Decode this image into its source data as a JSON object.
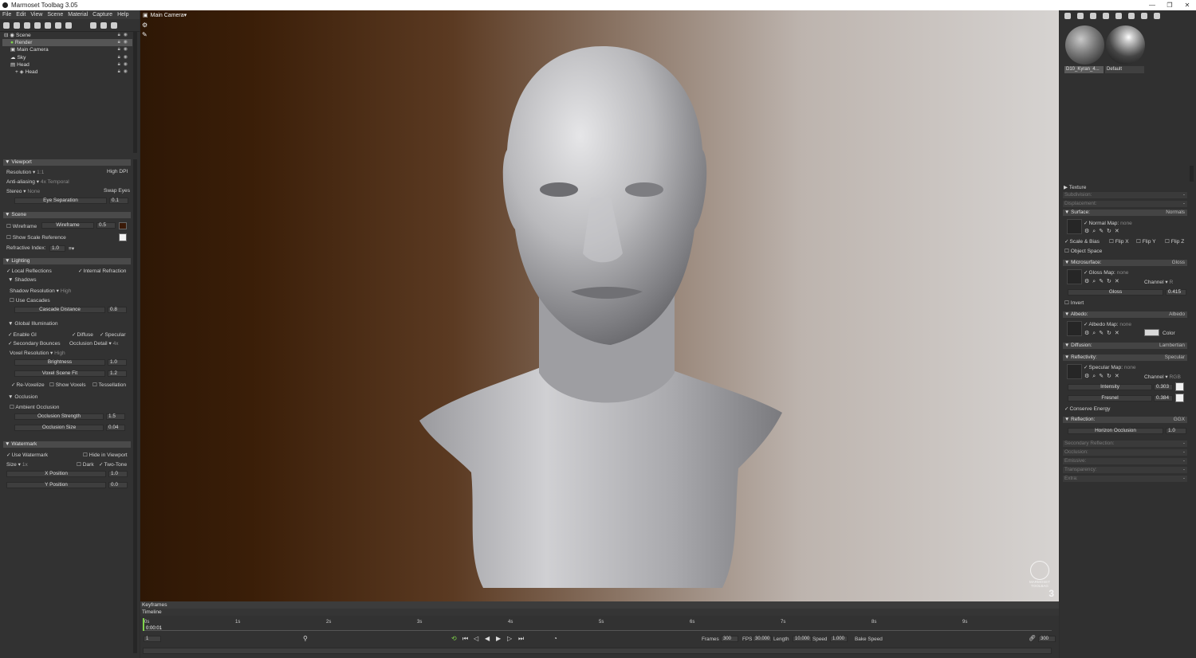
{
  "window": {
    "title": "Marmoset Toolbag 3.05",
    "controls": [
      "—",
      "❐",
      "✕"
    ]
  },
  "menu": [
    "File",
    "Edit",
    "View",
    "Scene",
    "Material",
    "Capture",
    "Help"
  ],
  "scene_tree": [
    {
      "label": "Scene",
      "indent": 0,
      "selected": false
    },
    {
      "label": "Render",
      "indent": 1,
      "selected": true
    },
    {
      "label": "Main Camera",
      "indent": 1,
      "selected": false
    },
    {
      "label": "Sky",
      "indent": 1,
      "selected": false
    },
    {
      "label": "Head",
      "indent": 1,
      "selected": false
    },
    {
      "label": "Head",
      "indent": 2,
      "selected": false
    }
  ],
  "viewport_panel": {
    "title": "Viewport",
    "resolution_label": "Resolution",
    "resolution_value": "1:1",
    "high_dpi": "High DPI",
    "aa_label": "Anti-aliasing",
    "aa_value": "4x Temporal",
    "stereo_label": "Stereo",
    "stereo_value": "None",
    "swap_eyes": "Swap Eyes",
    "eye_sep_label": "Eye Separation",
    "eye_sep_value": "0.1"
  },
  "scene_panel": {
    "title": "Scene",
    "wireframe_label": "Wireframe",
    "wireframe_slider": "Wireframe",
    "wireframe_value": "0.5",
    "show_scale": "Show Scale Reference",
    "refractive_label": "Refractive Index:",
    "refractive_value": "1.0"
  },
  "lighting_panel": {
    "title": "Lighting",
    "local_reflections": "Local Reflections",
    "internal_refraction": "Internal Refraction",
    "shadows": "Shadows",
    "shadow_res_label": "Shadow Resolution",
    "shadow_res_value": "High",
    "use_cascades": "Use Cascades",
    "cascade_label": "Cascade Distance",
    "cascade_value": "0.8",
    "gi": "Global Illumination",
    "enable_gi": "Enable GI",
    "diffuse": "Diffuse",
    "specular": "Specular",
    "secondary": "Secondary Bounces",
    "occ_detail_label": "Occlusion Detail",
    "occ_detail_value": "4x",
    "voxel_res_label": "Voxel Resolution",
    "voxel_res_value": "High",
    "brightness_label": "Brightness",
    "brightness_value": "1.0",
    "voxel_fit_label": "Voxel Scene Fit",
    "voxel_fit_value": "1.2",
    "revoxelize": "Re-Voxelize",
    "show_voxels": "Show Voxels",
    "tessellation": "Tessellation",
    "occlusion": "Occlusion",
    "ambient_occ": "Ambient Occlusion",
    "occ_strength_label": "Occlusion Strength",
    "occ_strength_value": "1.5",
    "occ_size_label": "Occlusion Size",
    "occ_size_value": "0.04"
  },
  "watermark_panel": {
    "title": "Watermark",
    "use_watermark": "Use Watermark",
    "hide_viewport": "Hide in Viewport",
    "size_label": "Size",
    "size_value": "1x",
    "dark": "Dark",
    "two_tone": "Two-Tone",
    "xpos_label": "X Position",
    "xpos_value": "1.0",
    "ypos_label": "Y Position",
    "ypos_value": "0.0"
  },
  "viewport": {
    "camera": "Main Camera",
    "watermark_brand": "MARMOSET",
    "watermark_product": "TOOLBAG",
    "watermark_version": "3"
  },
  "materials": [
    {
      "name": "D10_Kyran_4..."
    },
    {
      "name": "Default"
    }
  ],
  "material_panel": {
    "texture": "Texture",
    "subdivision": "Subdivision:",
    "displacement": "Displacement:",
    "surface": "Surface:",
    "surface_value": "Normals",
    "normal_map": "Normal Map:",
    "none": "none",
    "scale_bias": "Scale & Bias",
    "flip_x": "Flip X",
    "flip_y": "Flip Y",
    "flip_z": "Flip Z",
    "object_space": "Object Space",
    "microsurface": "Microsurface:",
    "microsurface_value": "Gloss",
    "gloss_map": "Gloss Map:",
    "channel": "Channel",
    "channel_r": "R",
    "gloss_label": "Gloss",
    "gloss_value": "0.415",
    "invert": "Invert",
    "albedo": "Albedo:",
    "albedo_value": "Albedo",
    "albedo_map": "Albedo Map:",
    "color": "Color",
    "diffusion": "Diffusion:",
    "diffusion_value": "Lambertian",
    "reflectivity": "Reflectivity:",
    "reflectivity_value": "Specular",
    "specular_map": "Specular Map:",
    "channel_rgb": "RGB",
    "intensity_label": "Intensity",
    "intensity_value": "0.303",
    "fresnel_label": "Fresnel",
    "fresnel_value": "0.384",
    "conserve": "Conserve Energy",
    "reflection": "Reflection:",
    "reflection_value": "GGX",
    "horizon_label": "Horizon Occlusion",
    "horizon_value": "1.0",
    "secondary_reflection": "Secondary Reflection:",
    "occlusion": "Occlusion:",
    "emissive": "Emissive:",
    "transparency": "Transparency:",
    "extra": "Extra:",
    "dash": "-"
  },
  "timeline": {
    "keyframes": "Keyframes",
    "timeline": "Timeline",
    "current_time": "0:00:01",
    "marks": [
      "0s",
      "1s",
      "2s",
      "3s",
      "4s",
      "5s",
      "6s",
      "7s",
      "8s",
      "9s"
    ],
    "frame_field": "1",
    "frames_label": "Frames",
    "frames_value": "300",
    "fps_label": "FPS",
    "fps_value": "30.000",
    "length_label": "Length",
    "length_value": "10.000",
    "speed_label": "Speed",
    "speed_value": "1.000",
    "bake_speed": "Bake Speed",
    "end_frame": "300"
  },
  "colors": {
    "accent_green": "#7fd34a",
    "selection": "#555555"
  }
}
